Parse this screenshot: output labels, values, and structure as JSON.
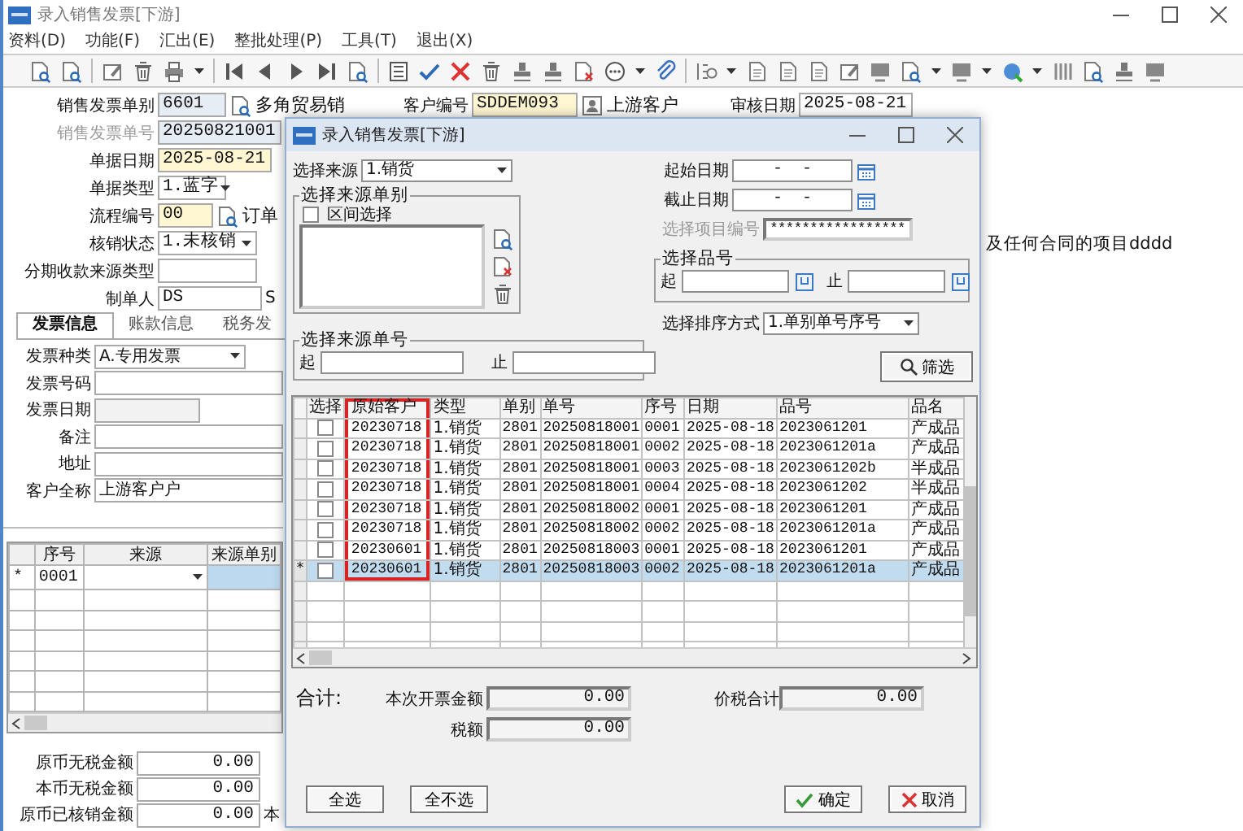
{
  "window": {
    "title": "录入销售发票[下游]"
  },
  "menu": [
    "资料(D)",
    "功能(F)",
    "汇出(E)",
    "整批处理(P)",
    "工具(T)",
    "退出(X)"
  ],
  "header_rows": [
    {
      "label": "销售发票单别",
      "value": "6601",
      "kind": "text",
      "disabled": false,
      "locked": true,
      "required": false,
      "link": "多角贸易销"
    },
    {
      "label": "销售发票单号",
      "value": "20250821001",
      "kind": "text",
      "disabled": true,
      "locked": true,
      "required": false
    },
    {
      "label": "单据日期",
      "value": "2025-08-21",
      "kind": "text",
      "disabled": false,
      "locked": false,
      "required": true
    },
    {
      "label": "单据类型",
      "value": "1.蓝字",
      "kind": "select",
      "disabled": false,
      "locked": false,
      "required": false
    },
    {
      "label": "流程编号",
      "value": "00",
      "kind": "text",
      "disabled": false,
      "locked": false,
      "required": true,
      "link": "订单"
    },
    {
      "label": "核销状态",
      "value": "1.未核销",
      "kind": "select",
      "disabled": false,
      "locked": false,
      "required": false
    },
    {
      "label": "分期收款来源类型",
      "kind": "text",
      "disabled": false,
      "locked": false,
      "required": false
    },
    {
      "label": "制单人",
      "value": "DS",
      "kind": "text",
      "disabled": false,
      "locked": false,
      "required": false,
      "trailing": "S"
    }
  ],
  "customer": {
    "label": "客户编号",
    "value": "SDDEM093",
    "name": "上游客户"
  },
  "review_date": {
    "label": "审核日期",
    "value": "2025-08-21"
  },
  "note": "及任何合同的项目dddd",
  "tabs": [
    {
      "label": "发票信息",
      "selected": true
    },
    {
      "label": "账款信息",
      "selected": false
    },
    {
      "label": "税务发",
      "selected": false
    }
  ],
  "invoice_fields": [
    {
      "label": "发票种类",
      "value": "A.专用发票",
      "kind": "select"
    },
    {
      "label": "发票号码",
      "kind": "text"
    },
    {
      "label": "发票日期",
      "kind": "short"
    },
    {
      "label": "备注",
      "kind": "text"
    },
    {
      "label": "地址",
      "kind": "text"
    },
    {
      "label": "客户全称",
      "value": "上游客户户",
      "kind": "text"
    }
  ],
  "detail_grid": {
    "columns": [
      "序号",
      "来源",
      "来源单别"
    ],
    "rows": [
      {
        "marker": "*",
        "seq": "0001",
        "focused": true
      }
    ]
  },
  "amounts": [
    {
      "label": "原币无税金额",
      "value": "0.00"
    },
    {
      "label": "本币无税金额",
      "value": "0.00"
    },
    {
      "label": "原币已核销金额",
      "value": "0.00",
      "trailing": "本"
    }
  ],
  "dialog": {
    "title": "录入销售发票[下游]",
    "source": {
      "label": "选择来源",
      "value": "1.销货"
    },
    "source_type_group": {
      "title": "选择来源单别",
      "range": {
        "label": "区间选择",
        "checked": false
      }
    },
    "source_no_group": {
      "title": "选择来源单号",
      "from_label": "起",
      "to_label": "止"
    },
    "start_date": {
      "label": "起始日期",
      "value": "-  -"
    },
    "end_date": {
      "label": "截止日期",
      "value": "-  -"
    },
    "project": {
      "label": "选择项目编号",
      "value": "*****************",
      "disabled": true
    },
    "item_group": {
      "title": "选择品号",
      "from_label": "起",
      "to_label": "止"
    },
    "sort": {
      "label": "选择排序方式",
      "value": "1.单别单号序号"
    },
    "filter_button": "筛选",
    "table": {
      "columns": [
        {
          "label": "选择",
          "highlighted": false
        },
        {
          "label": "原始客户",
          "highlighted": true
        },
        {
          "label": "类型",
          "highlighted": false
        },
        {
          "label": "单别",
          "highlighted": false
        },
        {
          "label": "单号",
          "highlighted": false
        },
        {
          "label": "序号",
          "highlighted": false
        },
        {
          "label": "日期",
          "highlighted": false
        },
        {
          "label": "品号",
          "highlighted": false
        },
        {
          "label": "品名",
          "highlighted": false
        }
      ],
      "rows": [
        {
          "checked": false,
          "selected": false,
          "cells": [
            "",
            "20230718",
            "1.销货",
            "2801",
            "20250818001",
            "0001",
            "2025-08-18",
            "2023061201",
            "产成品"
          ]
        },
        {
          "checked": false,
          "selected": false,
          "cells": [
            "",
            "20230718",
            "1.销货",
            "2801",
            "20250818001",
            "0002",
            "2025-08-18",
            "2023061201a",
            "产成品"
          ]
        },
        {
          "checked": false,
          "selected": false,
          "cells": [
            "",
            "20230718",
            "1.销货",
            "2801",
            "20250818001",
            "0003",
            "2025-08-18",
            "2023061202b",
            "半成品"
          ]
        },
        {
          "checked": false,
          "selected": false,
          "cells": [
            "",
            "20230718",
            "1.销货",
            "2801",
            "20250818001",
            "0004",
            "2025-08-18",
            "2023061202",
            "半成品"
          ]
        },
        {
          "checked": false,
          "selected": false,
          "cells": [
            "",
            "20230718",
            "1.销货",
            "2801",
            "20250818002",
            "0001",
            "2025-08-18",
            "2023061201",
            "产成品"
          ]
        },
        {
          "checked": false,
          "selected": false,
          "cells": [
            "",
            "20230718",
            "1.销货",
            "2801",
            "20250818002",
            "0002",
            "2025-08-18",
            "2023061201a",
            "产成品"
          ]
        },
        {
          "checked": false,
          "selected": false,
          "cells": [
            "",
            "20230601",
            "1.销货",
            "2801",
            "20250818003",
            "0001",
            "2025-08-18",
            "2023061201",
            "产成品"
          ]
        },
        {
          "checked": false,
          "selected": true,
          "marker": "*",
          "cells": [
            "",
            "20230601",
            "1.销货",
            "2801",
            "20250818003",
            "0002",
            "2025-08-18",
            "2023061201a",
            "产成品"
          ]
        }
      ]
    },
    "totals": {
      "label": "合计:",
      "fields": [
        {
          "label": "本次开票金额",
          "value": "0.00"
        },
        {
          "label": "价税合计",
          "value": "0.00"
        },
        {
          "label": "税额",
          "value": "0.00"
        }
      ]
    },
    "buttons": [
      {
        "label": "全选",
        "kind": "plain"
      },
      {
        "label": "全不选",
        "kind": "plain"
      },
      {
        "label": "确定",
        "kind": "ok"
      },
      {
        "label": "取消",
        "kind": "cancel"
      }
    ]
  }
}
